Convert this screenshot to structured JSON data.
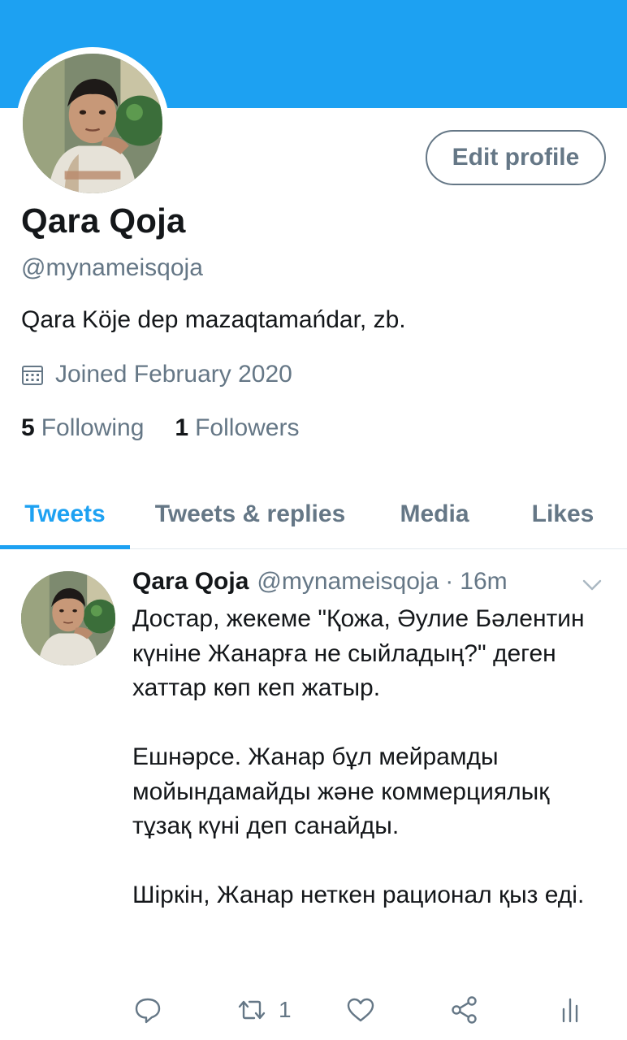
{
  "colors": {
    "accent": "#1da1f2",
    "secondary_text": "#657786",
    "primary_text": "#14171a",
    "divider": "#e1e8ed"
  },
  "profile": {
    "display_name": "Qara Qoja",
    "handle": "@mynameisqoja",
    "bio": "Qara Köje dep mazaqtamańdar, zb.",
    "joined_icon": "calendar-icon",
    "joined": "Joined February 2020",
    "edit_button": "Edit profile",
    "following_count": "5",
    "following_label": "Following",
    "followers_count": "1",
    "followers_label": "Followers"
  },
  "tabs": [
    {
      "label": "Tweets",
      "active": true
    },
    {
      "label": "Tweets & replies",
      "active": false
    },
    {
      "label": "Media",
      "active": false
    },
    {
      "label": "Likes",
      "active": false
    }
  ],
  "tweet": {
    "name": "Qara Qoja",
    "handle": "@mynameisqoja",
    "separator": "·",
    "time": "16m",
    "menu_icon": "chevron-down-icon",
    "paragraphs": [
      "Достар, жекеме \"Қожа, Әулие Бәлентин күніне Жанарға не сыйладың?\" деген хаттар көп кеп жатыр.",
      "Ешнәрсе. Жанар бұл мейрамды мойындамайды және коммерциялық тұзақ күні деп санайды.",
      "Шіркін, Жанар неткен рационал қыз еді."
    ],
    "actions": {
      "reply_icon": "reply-icon",
      "retweet_icon": "retweet-icon",
      "retweet_count": "1",
      "like_icon": "heart-icon",
      "share_icon": "share-icon",
      "analytics_icon": "analytics-icon"
    }
  }
}
